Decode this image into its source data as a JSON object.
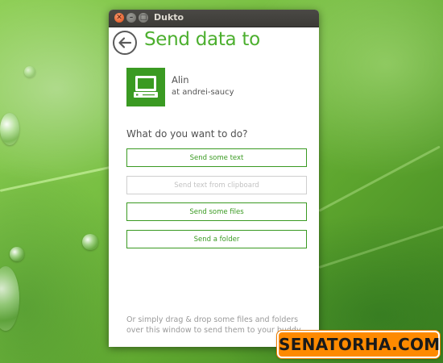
{
  "window": {
    "title": "Dukto"
  },
  "page": {
    "heading": "Send data to"
  },
  "buddy": {
    "name": "Alin",
    "host": "at andrei-saucy",
    "avatar_icon": "computer-icon",
    "avatar_color": "#3a9a22"
  },
  "actions": {
    "prompt": "What do you want to do?",
    "send_text": "Send some text",
    "send_clipboard": "Send text from clipboard",
    "send_files": "Send some files",
    "send_folder": "Send a folder"
  },
  "footer": {
    "hint": "Or simply drag & drop some files and folders over this window to send them to your buddy."
  },
  "watermark": {
    "text": "SENATORHA.COM"
  },
  "colors": {
    "accent": "#4caf2e",
    "button_border": "#3a9a22",
    "disabled": "#c2c2c2",
    "watermark_bg": "#fe8a00"
  }
}
